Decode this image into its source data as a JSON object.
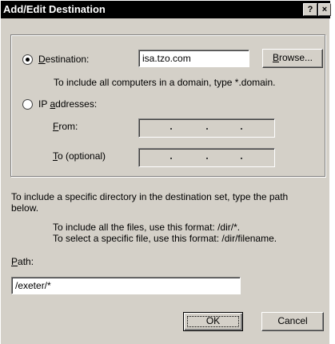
{
  "dialog": {
    "title": "Add/Edit Destination",
    "help_glyph": "?",
    "close_glyph": "×"
  },
  "destination": {
    "radio_label_prefix": "",
    "radio_label_accel": "D",
    "radio_label_rest": "estination:",
    "value": "isa.tzo.com",
    "browse_accel": "B",
    "browse_rest": "rowse...",
    "hint": "To include all computers in a domain, type *.domain."
  },
  "ip": {
    "radio_label_prefix": "IP ",
    "radio_label_accel": "a",
    "radio_label_rest": "ddresses:",
    "from_accel": "F",
    "from_rest": "rom:",
    "to_accel": "T",
    "to_rest": "o (optional)"
  },
  "info": {
    "line1": "To include a specific directory in the destination set, type the path",
    "line2": "below.",
    "line3": "To include all the files, use this format: /dir/*.",
    "line4": "To select a specific file, use this format: /dir/filename."
  },
  "path": {
    "label_accel": "P",
    "label_rest": "ath:",
    "value": "/exeter/*"
  },
  "buttons": {
    "ok": "OK",
    "cancel": "Cancel"
  }
}
